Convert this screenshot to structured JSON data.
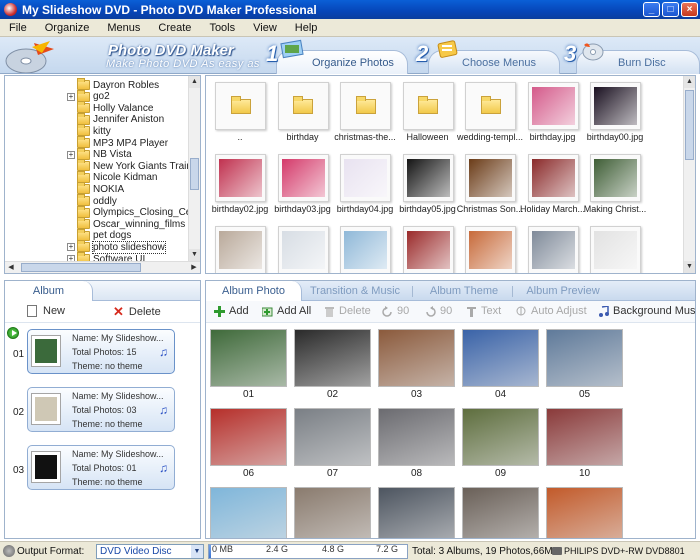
{
  "window": {
    "title": "My Slideshow DVD - Photo DVD Maker Professional"
  },
  "menu": [
    "File",
    "Organize",
    "Menus",
    "Create",
    "Tools",
    "View",
    "Help"
  ],
  "banner": {
    "app_name": "Photo DVD Maker",
    "tagline": "Make Photo DVD As easy as",
    "steps": [
      {
        "num": "1",
        "label": "Organize Photos"
      },
      {
        "num": "2",
        "label": "Choose Menus"
      },
      {
        "num": "3",
        "label": "Burn Disc"
      }
    ]
  },
  "folder_tree": [
    {
      "label": "Dayron Robles",
      "expandable": false
    },
    {
      "label": "go2",
      "expandable": true
    },
    {
      "label": "Holly Valance",
      "expandable": false
    },
    {
      "label": "Jennifer Aniston",
      "expandable": false
    },
    {
      "label": "kitty",
      "expandable": false
    },
    {
      "label": "MP3 MP4 Player",
      "expandable": false
    },
    {
      "label": "NB Vista",
      "expandable": true
    },
    {
      "label": "New York Giants Training C",
      "expandable": false
    },
    {
      "label": "Nicole Kidman",
      "expandable": false
    },
    {
      "label": "NOKIA",
      "expandable": false
    },
    {
      "label": "oddly",
      "expandable": false
    },
    {
      "label": "Olympics_Closing_Ceremon",
      "expandable": false
    },
    {
      "label": "Oscar_winning_films",
      "expandable": false
    },
    {
      "label": "pet dogs",
      "expandable": false
    },
    {
      "label": "photo slideshow",
      "expandable": true,
      "selected": true
    },
    {
      "label": "Software UI",
      "expandable": true
    }
  ],
  "browser": {
    "items": [
      {
        "name": "..",
        "kind": "folder"
      },
      {
        "name": "birthday",
        "kind": "folder"
      },
      {
        "name": "christmas-the...",
        "kind": "folder"
      },
      {
        "name": "Halloween",
        "kind": "folder"
      },
      {
        "name": "wedding-templ...",
        "kind": "folder"
      },
      {
        "name": "birthday.jpg",
        "kind": "photo",
        "color": "#d45a8a"
      },
      {
        "name": "birthday00.jpg",
        "kind": "photo",
        "color": "#1a1020"
      },
      {
        "name": "birthday02.jpg",
        "kind": "photo",
        "color": "#c0314f"
      },
      {
        "name": "birthday03.jpg",
        "kind": "photo",
        "color": "#d43a6a"
      },
      {
        "name": "birthday04.jpg",
        "kind": "photo",
        "color": "#e8e2f0"
      },
      {
        "name": "birthday05.jpg",
        "kind": "photo",
        "color": "#141414"
      },
      {
        "name": "Christmas Son...",
        "kind": "photo",
        "color": "#6b3c18"
      },
      {
        "name": "Holiday March...",
        "kind": "photo",
        "color": "#8a2a2a"
      },
      {
        "name": "Making Christ...",
        "kind": "photo",
        "color": "#3f5e36"
      },
      {
        "name": "",
        "kind": "photo",
        "color": "#b9a99a"
      },
      {
        "name": "",
        "kind": "photo",
        "color": "#d7dde4"
      },
      {
        "name": "",
        "kind": "photo",
        "color": "#8fb8d8"
      },
      {
        "name": "",
        "kind": "photo",
        "color": "#9a2a2a"
      },
      {
        "name": "",
        "kind": "photo",
        "color": "#c76a3a"
      },
      {
        "name": "",
        "kind": "photo",
        "color": "#7f8a99"
      },
      {
        "name": "",
        "kind": "photo",
        "color": "#e2e2e2"
      }
    ]
  },
  "album_panel": {
    "tab": "Album",
    "new_label": "New",
    "delete_label": "Delete",
    "albums": [
      {
        "index": "01",
        "name": "Name: My Slideshow...",
        "photos": "Total Photos: 15",
        "theme": "Theme: no theme",
        "color": "#3b6a3b"
      },
      {
        "index": "02",
        "name": "Name: My Slideshow...",
        "photos": "Total Photos: 03",
        "theme": "Theme: no theme",
        "color": "#cfc8b5"
      },
      {
        "index": "03",
        "name": "Name: My Slideshow...",
        "photos": "Total Photos: 01",
        "theme": "Theme: no theme",
        "color": "#111111"
      }
    ]
  },
  "main_tabs": [
    "Album Photo",
    "Transition & Music",
    "Album Theme",
    "Album Preview"
  ],
  "photo_toolbar": [
    {
      "label": "Add",
      "enabled": true,
      "icon": "plus-icon"
    },
    {
      "label": "Add All",
      "enabled": true,
      "icon": "add-all-icon"
    },
    {
      "label": "Delete",
      "enabled": false,
      "icon": "trash-icon"
    },
    {
      "label": "90",
      "enabled": false,
      "icon": "rotate-left-icon"
    },
    {
      "label": "90",
      "enabled": false,
      "icon": "rotate-right-icon"
    },
    {
      "label": "Text",
      "enabled": false,
      "icon": "text-icon"
    },
    {
      "label": "Auto Adjust",
      "enabled": false,
      "icon": "auto-adjust-icon"
    },
    {
      "label": "Background Music",
      "enabled": true,
      "icon": "music-icon"
    }
  ],
  "album_photos": [
    {
      "num": "01",
      "color": "#3f6a3a"
    },
    {
      "num": "02",
      "color": "#2a2a2a"
    },
    {
      "num": "03",
      "color": "#8b5a3c"
    },
    {
      "num": "04",
      "color": "#3a63a8"
    },
    {
      "num": "05",
      "color": "#5f7a9a"
    },
    {
      "num": "06",
      "color": "#b62f2a"
    },
    {
      "num": "07",
      "color": "#7a7f85"
    },
    {
      "num": "08",
      "color": "#6b6b70"
    },
    {
      "num": "09",
      "color": "#5e6e3e"
    },
    {
      "num": "10",
      "color": "#8a3a3a"
    },
    {
      "num": "",
      "color": "#7fb6da"
    },
    {
      "num": "",
      "color": "#8a7b6e"
    },
    {
      "num": "",
      "color": "#4d5560"
    },
    {
      "num": "",
      "color": "#6a6058"
    },
    {
      "num": "",
      "color": "#c25a2a"
    }
  ],
  "status": {
    "output_label": "Output Format:",
    "output_value": "DVD Video Disc",
    "capacity_ticks": [
      "0 MB",
      "2.4 G",
      "4.8 G",
      "7.2 G"
    ],
    "capacity_used_fraction": 0.01,
    "summary": "Total: 3 Albums, 19 Photos,66MB",
    "drive": "PHILIPS DVD+-RW DVD8801"
  }
}
